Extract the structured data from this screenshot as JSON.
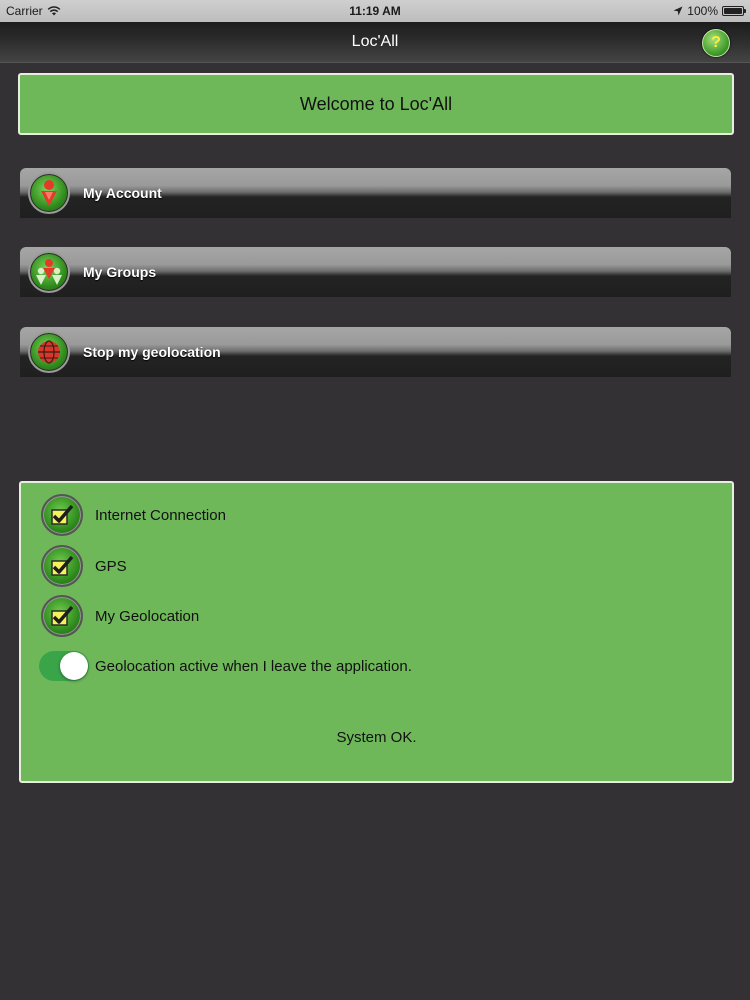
{
  "status_bar": {
    "carrier": "Carrier",
    "time": "11:19 AM",
    "battery": "100%",
    "icons": [
      "wifi-icon",
      "location-arrow-icon",
      "battery-icon"
    ]
  },
  "nav": {
    "title": "Loc'All",
    "help_label": "?"
  },
  "welcome": {
    "text": "Welcome to Loc'All"
  },
  "menu": {
    "items": [
      {
        "label": "My Account",
        "icon": "person-pin-icon"
      },
      {
        "label": "My Groups",
        "icon": "group-icon"
      },
      {
        "label": "Stop my geolocation",
        "icon": "globe-icon"
      }
    ]
  },
  "status_panel": {
    "checks": [
      {
        "label": "Internet Connection",
        "checked": true
      },
      {
        "label": "GPS",
        "checked": true
      },
      {
        "label": "My Geolocation",
        "checked": true
      }
    ],
    "toggle": {
      "label": "Geolocation active when I leave the application.",
      "on": true
    },
    "system_status": "System OK."
  },
  "colors": {
    "background": "#333134",
    "panel_green": "#6fb85a",
    "toggle_green": "#3aa449",
    "help_yellow": "#ffef3a"
  }
}
